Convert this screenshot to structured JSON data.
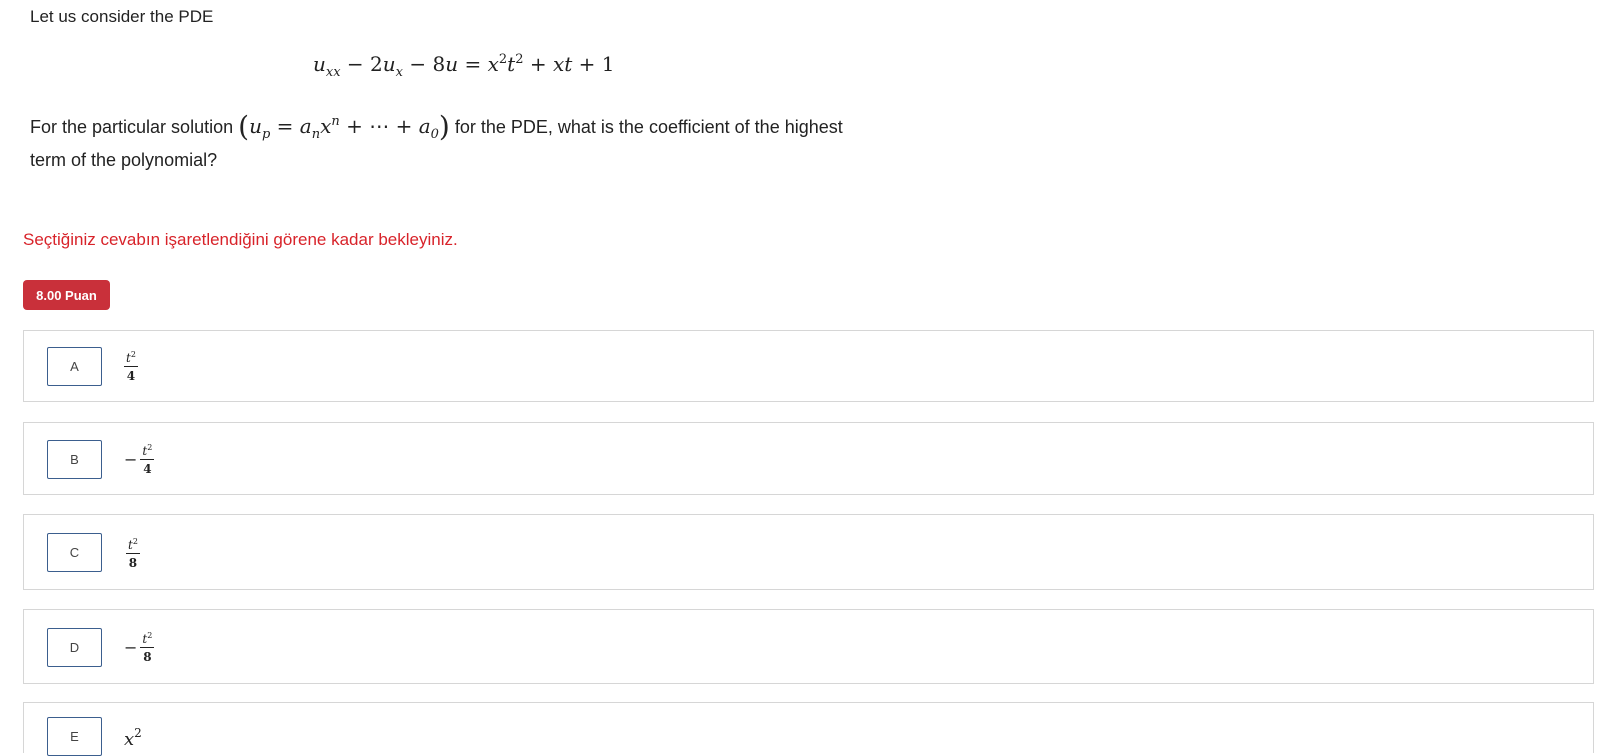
{
  "question": {
    "intro": "Let us consider the PDE",
    "line1_before": "For the particular solution",
    "line1_after": "for the PDE, what is the coefficient of the highest",
    "line2": "term of the polynomial?"
  },
  "warning": "Seçtiğiniz cevabın işaretlendiğini görene kadar bekleyiniz.",
  "points_badge": "8.00 Puan",
  "options": [
    {
      "letter": "A",
      "sign": "",
      "num": "t",
      "exp": "2",
      "den": "4"
    },
    {
      "letter": "B",
      "sign": "−",
      "num": "t",
      "exp": "2",
      "den": "4"
    },
    {
      "letter": "C",
      "sign": "",
      "num": "t",
      "exp": "2",
      "den": "8"
    },
    {
      "letter": "D",
      "sign": "−",
      "num": "t",
      "exp": "2",
      "den": "8"
    },
    {
      "letter": "E",
      "base": "x",
      "exp": "2"
    }
  ]
}
